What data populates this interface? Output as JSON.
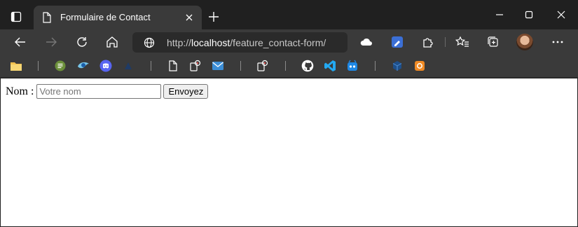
{
  "browser": {
    "tab_title": "Formulaire de Contact",
    "url_scheme": "http://",
    "url_host": "localhost",
    "url_path": "/feature_contact-form/"
  },
  "page": {
    "name_label": "Nom :",
    "name_placeholder": "Votre nom",
    "submit_label": "Envoyez"
  },
  "icons": {
    "tab_actions": "tab-actions-icon",
    "favicon": "document-icon",
    "close_tab": "close-icon",
    "new_tab": "plus-icon",
    "back": "arrow-left-icon",
    "forward": "arrow-right-icon",
    "refresh": "refresh-icon",
    "home": "home-icon",
    "site_info": "globe-icon",
    "extensions": "puzzle-icon",
    "favorites": "star-list-icon",
    "collections": "collections-icon",
    "menu": "ellipsis-icon"
  },
  "colors": {
    "chrome_dark": "#202020",
    "toolbar": "#3a3a3a",
    "vscode_blue": "#23a9f2",
    "discord": "#5865f2"
  }
}
